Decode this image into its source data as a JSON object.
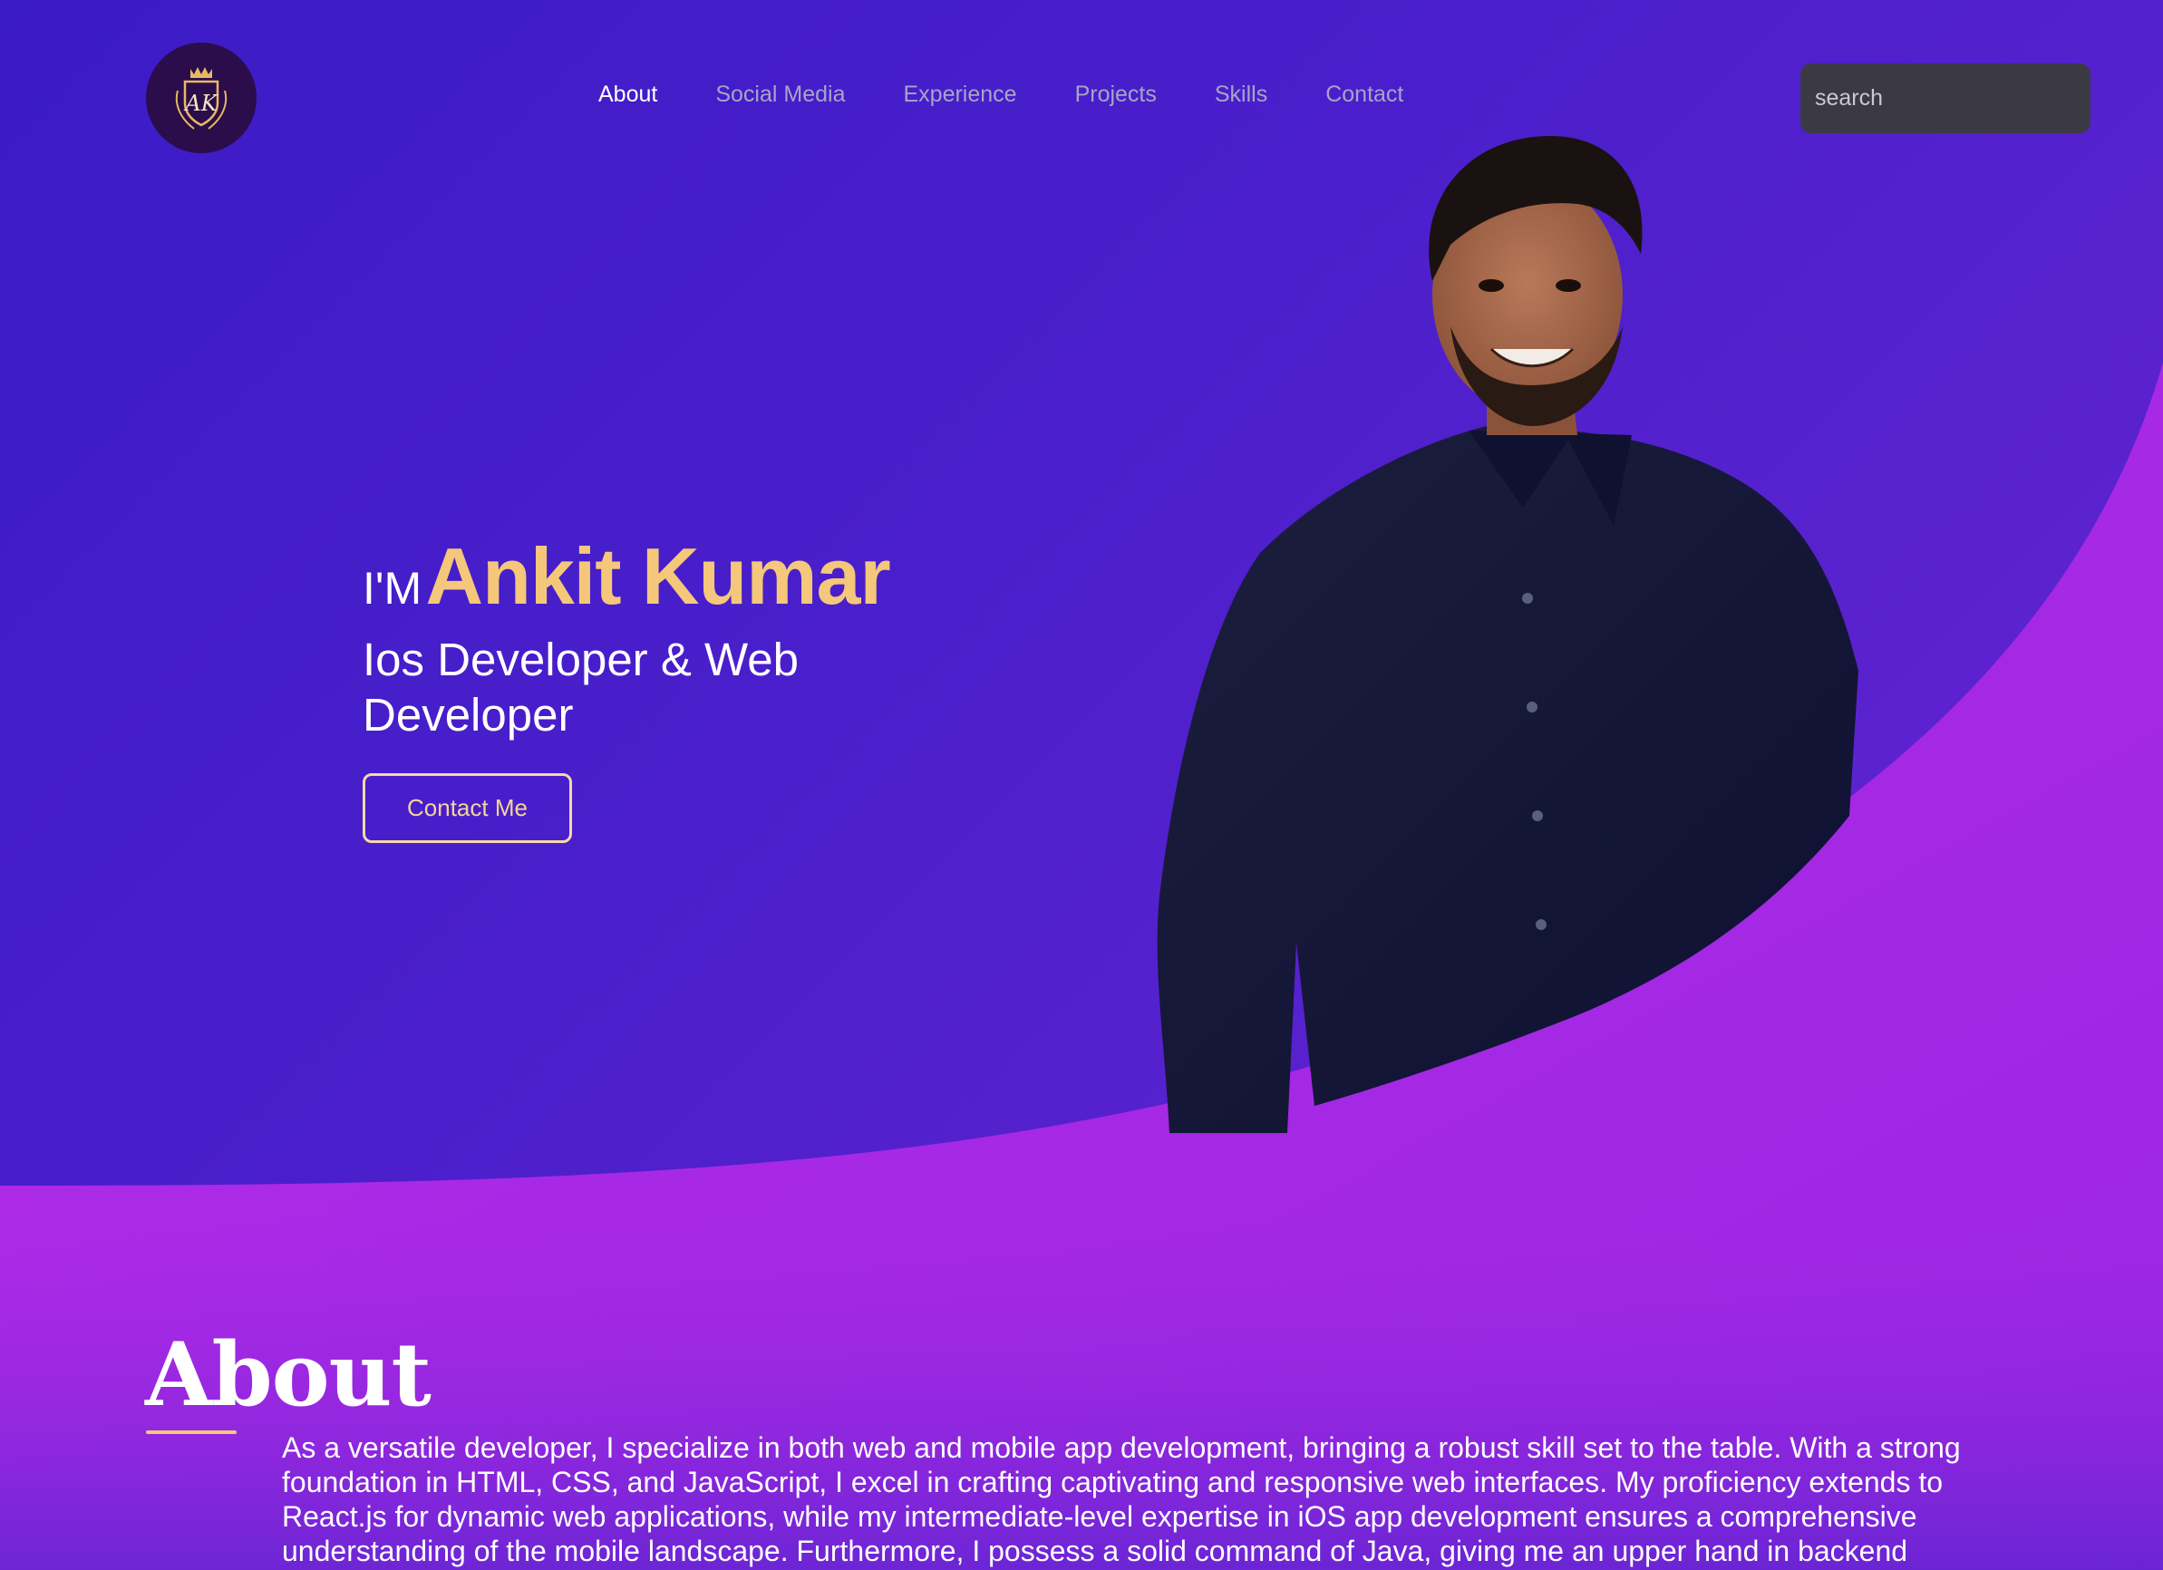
{
  "nav": {
    "items": [
      {
        "label": "About",
        "active": true
      },
      {
        "label": "Social Media",
        "active": false
      },
      {
        "label": "Experience",
        "active": false
      },
      {
        "label": "Projects",
        "active": false
      },
      {
        "label": "Skills",
        "active": false
      },
      {
        "label": "Contact",
        "active": false
      }
    ],
    "logo_initials": "AK",
    "logo_icon": "crest-logo-icon"
  },
  "search": {
    "placeholder": "search",
    "value": "",
    "icon": "search-icon"
  },
  "hero": {
    "intro": "I'M",
    "name": "Ankit Kumar",
    "role": "Ios Developer & Web Developer",
    "cta_label": "Contact Me"
  },
  "about": {
    "title": "About",
    "text": "As a versatile developer, I specialize in both web and mobile app development, bringing a robust skill set to the table. With a strong foundation in HTML, CSS, and JavaScript, I excel in crafting captivating and responsive web interfaces. My proficiency extends to React.js for dynamic web applications, while my intermediate-level expertise in iOS app development ensures a comprehensive understanding of the mobile landscape. Furthermore, I possess a solid command of Java, giving me an upper hand in backend"
  },
  "colors": {
    "accent": "#f4c77a",
    "background_start": "#3b1bc6",
    "wave": "#a528e6",
    "search_bg": "#3b3a44",
    "nav_inactive": "#a9a3c8"
  }
}
